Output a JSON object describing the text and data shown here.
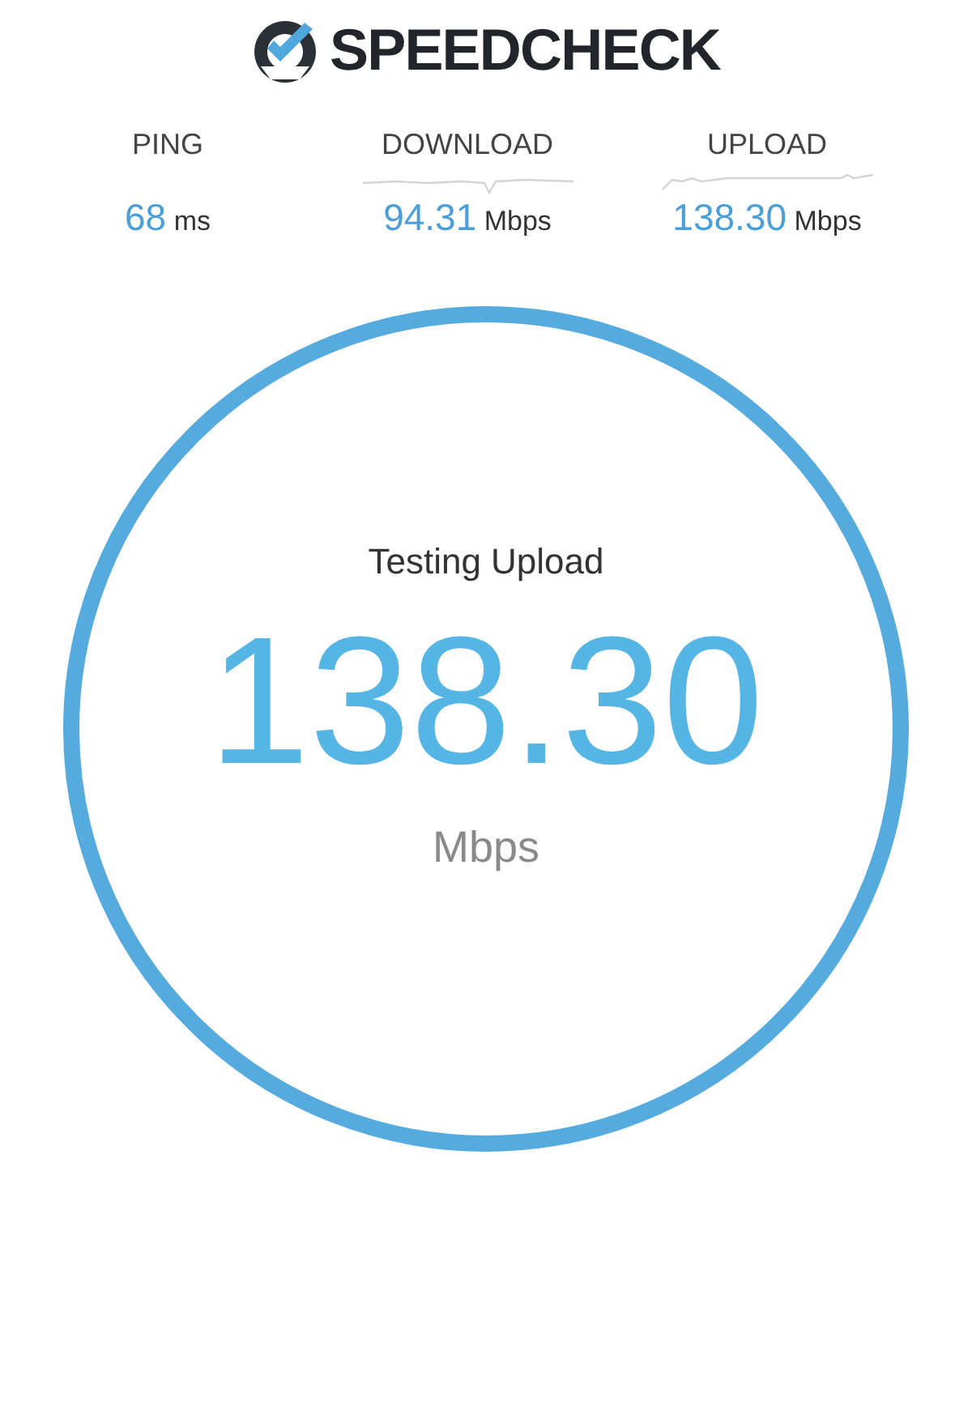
{
  "logo": {
    "text": "SPEEDCHECK"
  },
  "stats": [
    {
      "label": "PING",
      "value": "68",
      "unit": "ms",
      "sparkline": false
    },
    {
      "label": "DOWNLOAD",
      "value": "94.31",
      "unit": "Mbps",
      "sparkline": true
    },
    {
      "label": "UPLOAD",
      "value": "138.30",
      "unit": "Mbps",
      "sparkline": true
    }
  ],
  "gauge": {
    "status": "Testing Upload",
    "value": "138.30",
    "unit": "Mbps"
  }
}
